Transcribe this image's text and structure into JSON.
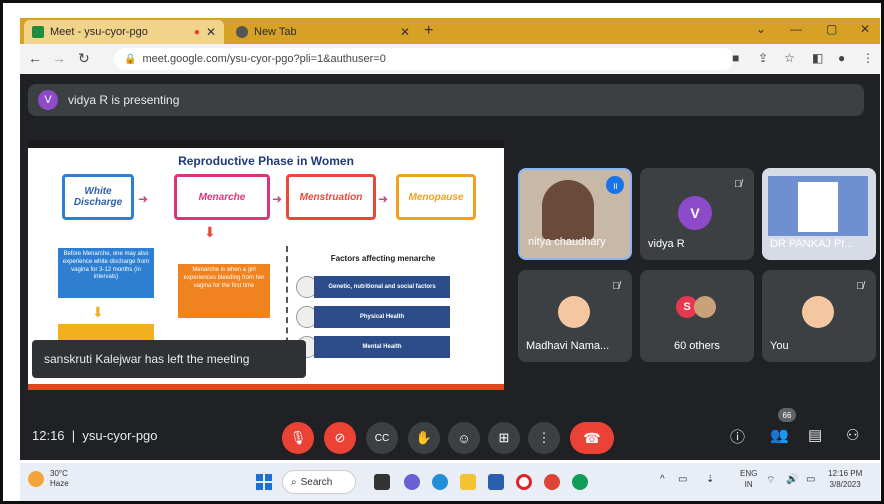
{
  "browser": {
    "tabs": [
      {
        "title": "Meet - ysu-cyor-pgo",
        "active": true
      },
      {
        "title": "New Tab",
        "active": false
      }
    ],
    "new_tab_label": "+",
    "url": "meet.google.com/ysu-cyor-pgo?pli=1&authuser=0"
  },
  "meet": {
    "presenting_initial": "V",
    "presenting_text": "vidya R is presenting",
    "slide": {
      "title": "Reproductive Phase in Women",
      "phases": [
        "White Discharge",
        "Menarche",
        "Menstruation",
        "Menopause"
      ],
      "note_left": "Before Menarche, one may also experience white discharge from vagina for 3-12 months (in intervals)",
      "note_center": "Menarche is when a girl experiences bleeding from her vagina for the first time",
      "factors_title": "Factors affecting menarche",
      "factors": [
        "Genetic, nutritional and social factors",
        "Physical Health",
        "Mental Health"
      ]
    },
    "toast": "sanskruti Kalejwar has left the meeting",
    "participants": [
      {
        "name": "nitya chaudhary"
      },
      {
        "name": "vidya R",
        "initial": "V"
      },
      {
        "name": "DR PANKAJ PI..."
      },
      {
        "name": "Madhavi Nama..."
      },
      {
        "name": "60 others",
        "initial": "S"
      },
      {
        "name": "You"
      }
    ],
    "time": "12:16",
    "meeting_code": "ysu-cyor-pgo",
    "participant_count": "66"
  },
  "taskbar": {
    "weather_temp": "30°C",
    "weather_desc": "Haze",
    "search_label": "Search",
    "lang_line1": "ENG",
    "lang_line2": "IN",
    "clock_time": "12:16 PM",
    "clock_date": "3/8/2023"
  },
  "colors": {
    "meet_bg": "#202124",
    "tile_bg": "#3c4043",
    "end_call": "#ea4335",
    "tab_bar": "#d7a126",
    "slide_title": "#1f3a7a"
  }
}
